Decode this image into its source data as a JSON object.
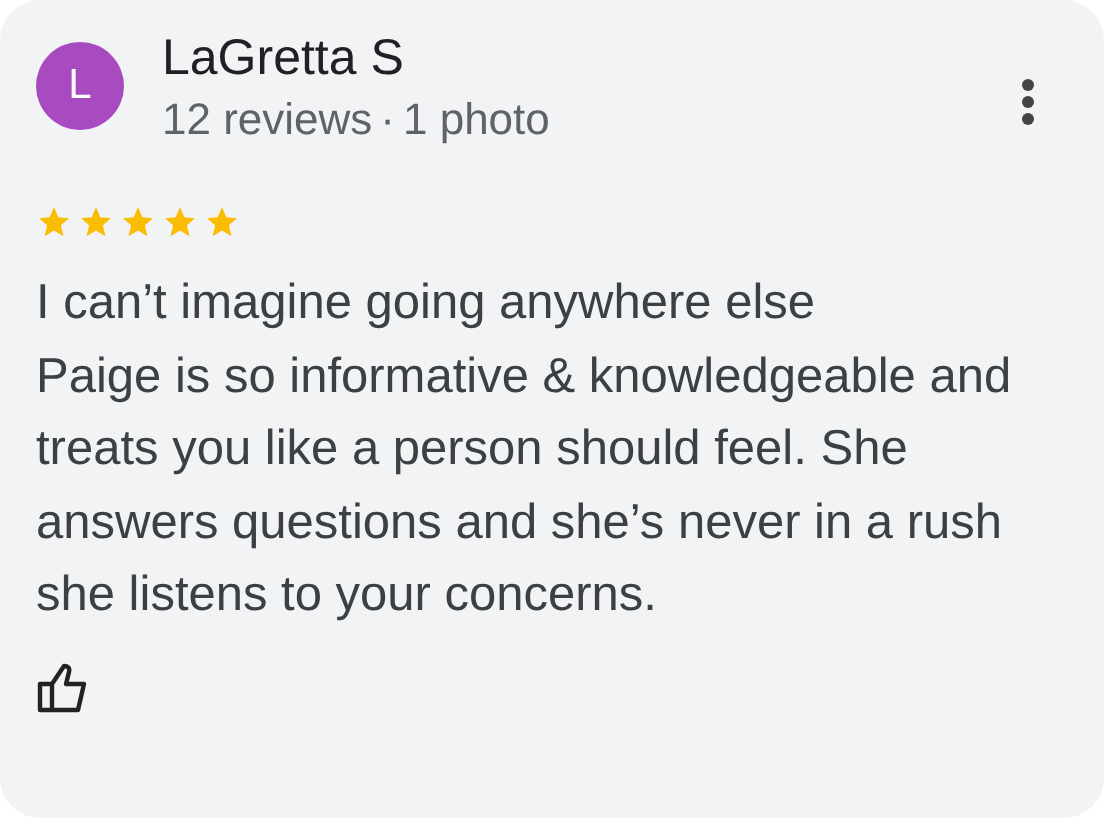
{
  "review": {
    "avatar_letter": "L",
    "name": "LaGretta S",
    "reviews": "12 reviews",
    "separator": "·",
    "photos": "1 photo",
    "stars": 5,
    "text": "I can’t imagine going anywhere else\nPaige is so informative & knowledgeable and treats you like a person should feel. She answers questions and she’s never in a rush she listens to your concerns."
  }
}
